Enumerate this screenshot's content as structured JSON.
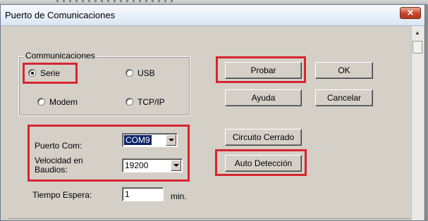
{
  "window": {
    "title": "Puerto de Comunicaciones",
    "close_label": "✕"
  },
  "communications": {
    "group_label": "Communicaciones",
    "options": [
      {
        "label": "Serie",
        "selected": true
      },
      {
        "label": "USB",
        "selected": false
      },
      {
        "label": "Modem",
        "selected": false
      },
      {
        "label": "TCP/IP",
        "selected": false
      }
    ]
  },
  "port": {
    "label": "Puerto Com:",
    "value": "COM9"
  },
  "baud": {
    "label_line1": "Velocidad en",
    "label_line2": "Baudios:",
    "value": "19200"
  },
  "timeout": {
    "label": "Tiempo Espera:",
    "value": "1",
    "unit": "min."
  },
  "buttons": {
    "probar": "Probar",
    "ok": "OK",
    "ayuda": "Ayuda",
    "cancelar": "Cancelar",
    "circuito": "Circuito Cerrado",
    "auto": "Auto Detección"
  },
  "colors": {
    "highlight": "#d6262f",
    "dialog_bg": "#d4d0c8"
  }
}
